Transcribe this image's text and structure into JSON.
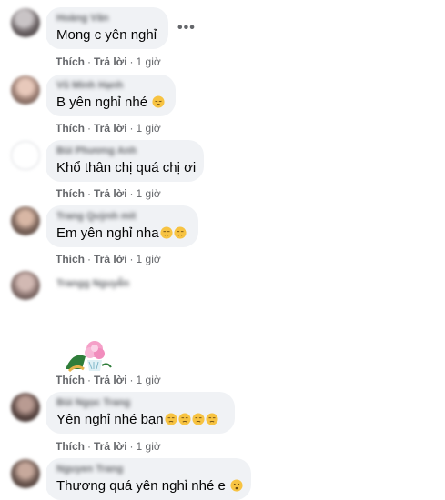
{
  "comments": [
    {
      "author": "Hoàng Văn",
      "text": "Mong c yên nghỉ",
      "like": "Thích",
      "reply": "Trả lời",
      "time": "1 giờ",
      "emoji_icons": []
    },
    {
      "author": "Vũ Minh Hạnh",
      "text": "B yên nghỉ nhé",
      "like": "Thích",
      "reply": "Trả lời",
      "time": "1 giờ",
      "emoji_icons": [
        "pensive-face-emoji"
      ]
    },
    {
      "author": "Bùi Phương Anh",
      "text": "Khổ thân chị quá chị ơi",
      "like": "Thích",
      "reply": "Trả lời",
      "time": "1 giờ",
      "emoji_icons": []
    },
    {
      "author": "Trang Quỳnh mit",
      "text": "Em yên nghỉ nha",
      "like": "Thích",
      "reply": "Trả lời",
      "time": "1 giờ",
      "emoji_icons": [
        "downcast-face-emoji",
        "downcast-face-emoji"
      ]
    },
    {
      "author": "Trangg Nguyễn",
      "text": "",
      "like": "Thích",
      "reply": "Trả lời",
      "time": "1 giờ",
      "emoji_icons": [],
      "sticker": "flower-sticker"
    },
    {
      "author": "Bùi Ngọc Trang",
      "text": "Yên nghỉ nhé bạn",
      "like": "Thích",
      "reply": "Trả lời",
      "time": "1 giờ",
      "emoji_icons": [
        "downcast-face-emoji",
        "downcast-face-emoji",
        "downcast-face-emoji",
        "downcast-face-emoji"
      ]
    },
    {
      "author": "Nguyen Trang",
      "text": "Thương quá yên nghỉ nhé e",
      "like": "Thích",
      "reply": "Trả lời",
      "time": "",
      "emoji_icons": [
        "frowning-face-emoji"
      ]
    }
  ],
  "more_options_icon": "more-horizontal-icon",
  "colors": {
    "bubble": "#f0f2f5",
    "meta_text": "#65676b",
    "emoji_yellow": "#f7c342"
  }
}
